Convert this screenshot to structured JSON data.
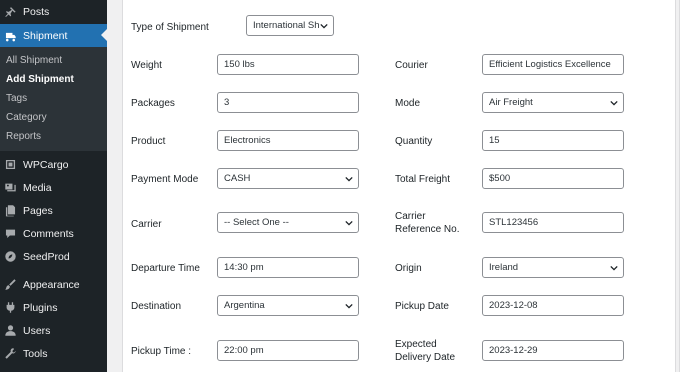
{
  "sidebar": {
    "posts": "Posts",
    "shipment": "Shipment",
    "submenu": [
      "All Shipment",
      "Add Shipment",
      "Tags",
      "Category",
      "Reports"
    ],
    "wpcargo": "WPCargo",
    "media": "Media",
    "pages": "Pages",
    "comments": "Comments",
    "seedprod": "SeedProd",
    "appearance": "Appearance",
    "plugins": "Plugins",
    "users": "Users",
    "tools": "Tools"
  },
  "form": {
    "type_of_shipment": {
      "label": "Type of Shipment",
      "value": "International Sh"
    },
    "weight": {
      "label": "Weight",
      "value": "150 lbs"
    },
    "courier": {
      "label": "Courier",
      "value": "Efficient Logistics Excellence"
    },
    "packages": {
      "label": "Packages",
      "value": "3"
    },
    "mode": {
      "label": "Mode",
      "value": "Air Freight"
    },
    "product": {
      "label": "Product",
      "value": "Electronics"
    },
    "quantity": {
      "label": "Quantity",
      "value": "15"
    },
    "payment_mode": {
      "label": "Payment Mode",
      "value": "CASH"
    },
    "total_freight": {
      "label": "Total Freight",
      "value": "$500"
    },
    "carrier": {
      "label": "Carrier",
      "value": "-- Select One --"
    },
    "carrier_reference": {
      "label_line1": "Carrier",
      "label_line2": "Reference No.",
      "value": "STL123456"
    },
    "departure_time": {
      "label": "Departure Time",
      "value": "14:30 pm"
    },
    "origin": {
      "label": "Origin",
      "value": "Ireland"
    },
    "destination": {
      "label": "Destination",
      "value": "Argentina"
    },
    "pickup_date": {
      "label": "Pickup Date",
      "value": "2023-12-08"
    },
    "pickup_time": {
      "label": "Pickup Time :",
      "value": "22:00 pm"
    },
    "expected_delivery": {
      "label_line1": "Expected",
      "label_line2": "Delivery Date",
      "value": "2023-12-29"
    }
  },
  "colors": {
    "sidebar_bg": "#1d2327",
    "active_bg": "#2271b1",
    "submenu_bg": "#2c3338",
    "field_border": "#8c8f94"
  }
}
